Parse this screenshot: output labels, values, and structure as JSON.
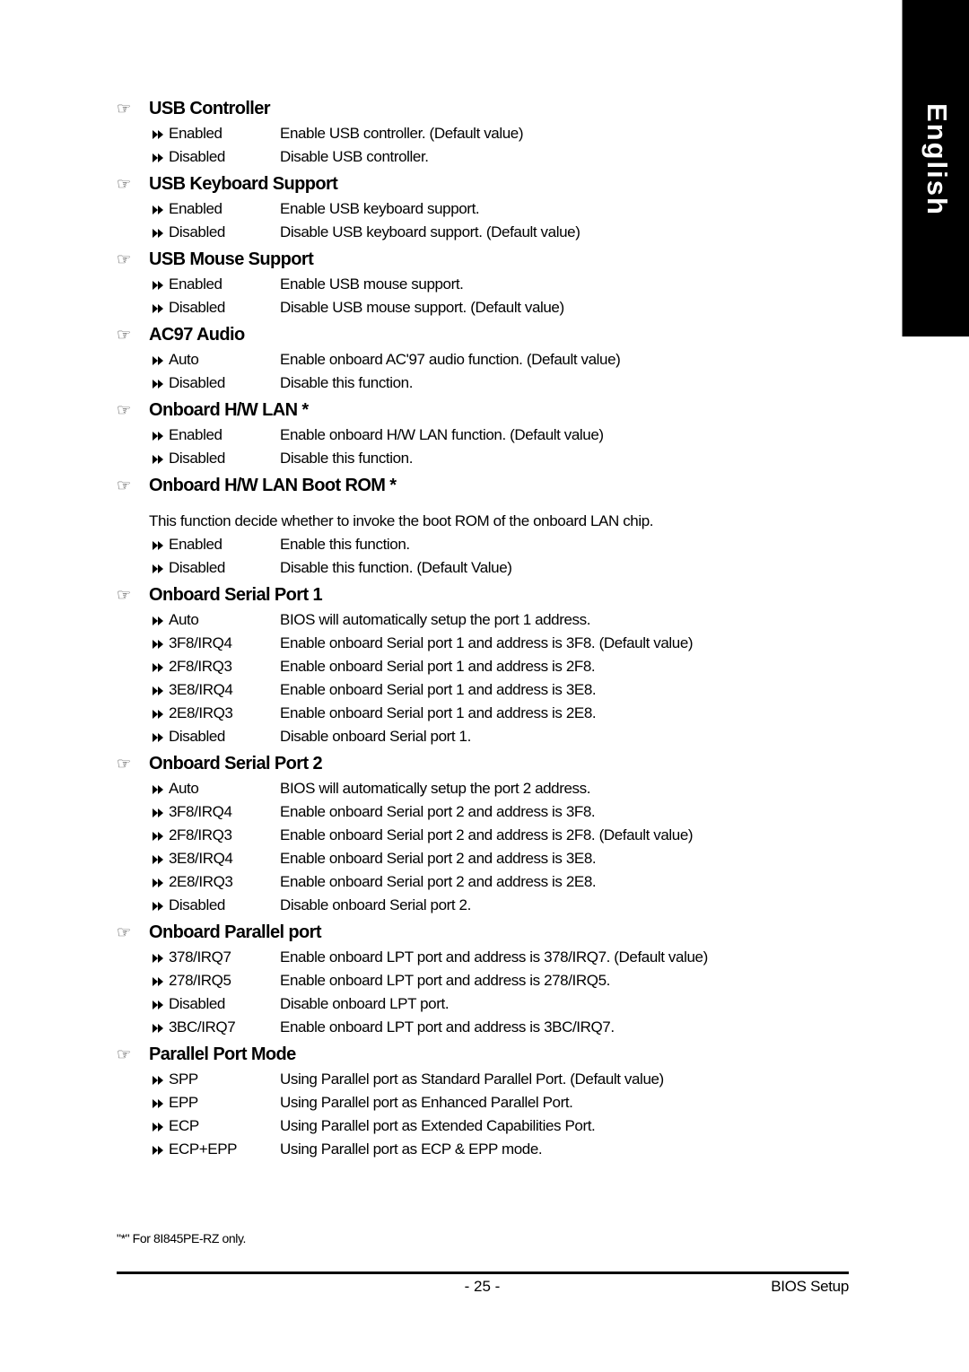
{
  "side_tab": {
    "label": "English"
  },
  "icons": {
    "heading": "pointing-hand-icon",
    "option": "double-arrow-icon"
  },
  "sections": [
    {
      "title": "USB Controller",
      "note": null,
      "options": [
        {
          "name": "Enabled",
          "desc": "Enable USB controller. (Default value)"
        },
        {
          "name": "Disabled",
          "desc": "Disable USB controller."
        }
      ]
    },
    {
      "title": "USB Keyboard Support",
      "note": null,
      "options": [
        {
          "name": "Enabled",
          "desc": "Enable USB keyboard support."
        },
        {
          "name": "Disabled",
          "desc": "Disable USB keyboard support. (Default value)"
        }
      ]
    },
    {
      "title": "USB Mouse Support",
      "note": null,
      "options": [
        {
          "name": "Enabled",
          "desc": "Enable USB mouse support."
        },
        {
          "name": "Disabled",
          "desc": "Disable USB mouse support. (Default value)"
        }
      ]
    },
    {
      "title": "AC97 Audio",
      "note": null,
      "options": [
        {
          "name": "Auto",
          "desc": "Enable onboard AC'97 audio function. (Default value)"
        },
        {
          "name": "Disabled",
          "desc": "Disable this function."
        }
      ]
    },
    {
      "title": "Onboard H/W LAN *",
      "note": null,
      "options": [
        {
          "name": "Enabled",
          "desc": "Enable onboard H/W LAN function. (Default value)"
        },
        {
          "name": "Disabled",
          "desc": "Disable this function."
        }
      ]
    },
    {
      "title": "Onboard H/W LAN Boot ROM *",
      "note": "This function decide whether to invoke the boot ROM of the onboard LAN chip.",
      "options": [
        {
          "name": "Enabled",
          "desc": "Enable this function."
        },
        {
          "name": "Disabled",
          "desc": "Disable this function. (Default Value)"
        }
      ]
    },
    {
      "title": "Onboard Serial Port 1",
      "note": null,
      "options": [
        {
          "name": "Auto",
          "desc": "BIOS will automatically setup the port 1 address."
        },
        {
          "name": "3F8/IRQ4",
          "desc": "Enable onboard Serial port 1 and address is 3F8. (Default value)"
        },
        {
          "name": "2F8/IRQ3",
          "desc": "Enable onboard Serial port 1 and address is 2F8."
        },
        {
          "name": "3E8/IRQ4",
          "desc": "Enable onboard Serial port 1 and address is 3E8."
        },
        {
          "name": "2E8/IRQ3",
          "desc": "Enable onboard Serial port 1 and address is 2E8."
        },
        {
          "name": "Disabled",
          "desc": "Disable onboard Serial port 1."
        }
      ]
    },
    {
      "title": "Onboard Serial Port 2",
      "note": null,
      "options": [
        {
          "name": "Auto",
          "desc": "BIOS will automatically setup the port 2 address."
        },
        {
          "name": "3F8/IRQ4",
          "desc": "Enable onboard Serial port 2 and address is 3F8."
        },
        {
          "name": "2F8/IRQ3",
          "desc": "Enable onboard Serial port 2 and address is 2F8. (Default value)"
        },
        {
          "name": "3E8/IRQ4",
          "desc": "Enable onboard Serial port 2 and address is 3E8."
        },
        {
          "name": "2E8/IRQ3",
          "desc": "Enable onboard Serial port 2 and address is 2E8."
        },
        {
          "name": "Disabled",
          "desc": "Disable onboard Serial port 2."
        }
      ]
    },
    {
      "title": "Onboard Parallel port",
      "note": null,
      "options": [
        {
          "name": "378/IRQ7",
          "desc": "Enable onboard LPT port and address is 378/IRQ7. (Default value)"
        },
        {
          "name": "278/IRQ5",
          "desc": "Enable onboard LPT port and address is 278/IRQ5."
        },
        {
          "name": "Disabled",
          "desc": "Disable onboard LPT port."
        },
        {
          "name": "3BC/IRQ7",
          "desc": "Enable onboard LPT port and address is 3BC/IRQ7."
        }
      ]
    },
    {
      "title": "Parallel Port Mode",
      "note": null,
      "options": [
        {
          "name": "SPP",
          "desc": "Using Parallel port as Standard Parallel Port. (Default value)"
        },
        {
          "name": "EPP",
          "desc": "Using Parallel port as Enhanced Parallel Port."
        },
        {
          "name": "ECP",
          "desc": "Using Parallel port as Extended Capabilities Port."
        },
        {
          "name": "ECP+EPP",
          "desc": "Using Parallel port as ECP & EPP mode."
        }
      ]
    }
  ],
  "footnote": "\"*\" For 8I845PE-RZ only.",
  "footer": {
    "page_number": "- 25 -",
    "doc_title": "BIOS Setup"
  }
}
